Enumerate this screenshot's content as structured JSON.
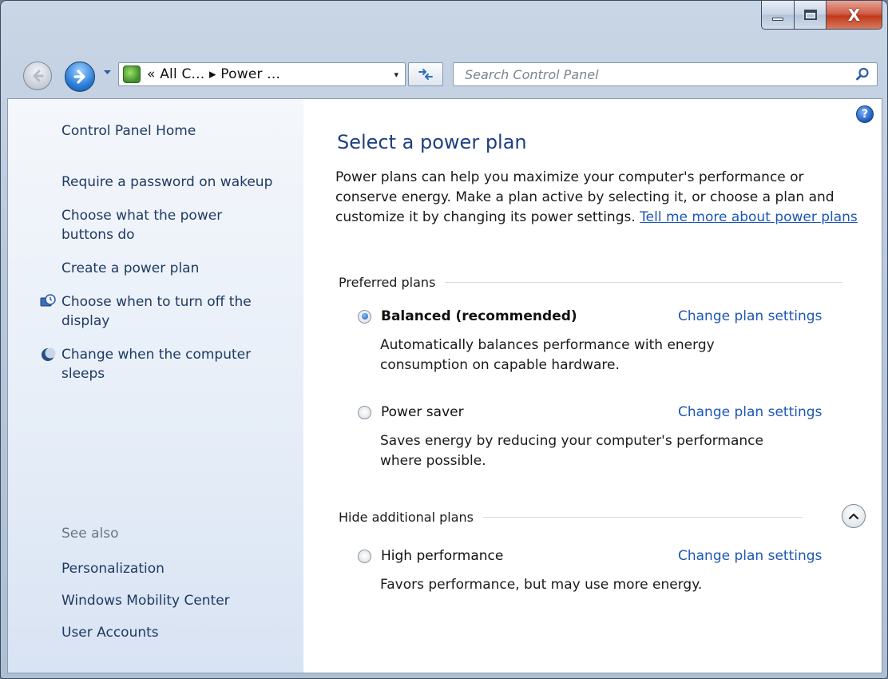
{
  "window": {
    "caption": {
      "minimize": "–",
      "maximize": "□",
      "close": "X"
    }
  },
  "nav": {
    "back_icon": "back-arrow-icon",
    "forward_icon": "forward-arrow-icon",
    "address": {
      "icon": "control-panel-icon",
      "breadcrumb": "« All C... ▸ Power ...",
      "dropdown_glyph": "▾"
    },
    "refresh_glyph": "↻",
    "search": {
      "placeholder": "Search Control Panel",
      "value": ""
    }
  },
  "sidebar": {
    "home": "Control Panel Home",
    "links": [
      {
        "label": "Require a password on wakeup",
        "icon": null
      },
      {
        "label": "Choose what the power buttons do",
        "icon": null
      },
      {
        "label": "Create a power plan",
        "icon": null
      },
      {
        "label": "Choose when to turn off the display",
        "icon": "monitor-clock-icon"
      },
      {
        "label": "Change when the computer sleeps",
        "icon": "moon-icon"
      }
    ],
    "see_also_label": "See also",
    "see_also": [
      "Personalization",
      "Windows Mobility Center",
      "User Accounts"
    ]
  },
  "main": {
    "help_glyph": "?",
    "title": "Select a power plan",
    "intro_text": "Power plans can help you maximize your computer's performance or conserve energy. Make a plan active by selecting it, or choose a plan and customize it by changing its power settings. ",
    "intro_link": "Tell me more about power plans",
    "preferred_header": "Preferred plans",
    "additional_header": "Hide additional plans",
    "plans": [
      {
        "name": "Balanced (recommended)",
        "selected": true,
        "link": "Change plan settings",
        "description": "Automatically balances performance with energy consumption on capable hardware."
      },
      {
        "name": "Power saver",
        "selected": false,
        "link": "Change plan settings",
        "description": "Saves energy by reducing your computer's performance where possible."
      },
      {
        "name": "High performance",
        "selected": false,
        "link": "Change plan settings",
        "description": "Favors performance, but may use more energy."
      }
    ]
  }
}
